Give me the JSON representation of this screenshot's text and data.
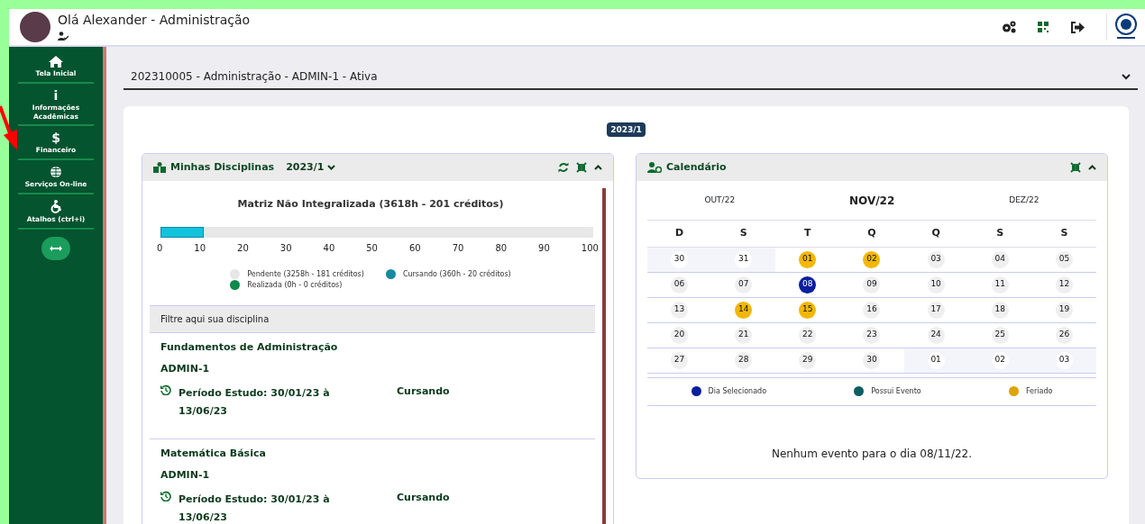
{
  "header": {
    "greeting": "Olá Alexander - Administração"
  },
  "sidebar": {
    "items": [
      {
        "label": "Tela Inicial",
        "kind": "home"
      },
      {
        "label": "Informações Acadêmicas",
        "kind": "glyph",
        "glyph": "i"
      },
      {
        "label": "Financeiro",
        "kind": "glyph",
        "glyph": "$"
      },
      {
        "label": "Serviços On-line",
        "kind": "globe"
      },
      {
        "label": "Atalhos (ctrl+i)",
        "kind": "access"
      }
    ]
  },
  "course_select": {
    "value": "202310005 - Administração - ADMIN-1 - Ativa"
  },
  "period_badge": "2023/1",
  "disciplinas": {
    "title": "Minhas Disciplinas",
    "period": "2023/1",
    "progress": {
      "title": "Matriz Não Integralizada (3618h - 201 créditos)",
      "level": 0.1,
      "ticks": [
        "0",
        "10",
        "20",
        "30",
        "40",
        "50",
        "60",
        "70",
        "80",
        "90",
        "100"
      ]
    },
    "legend": [
      {
        "label": "Pendente (3258h - 181 créditos)",
        "color": "#e6e6e6"
      },
      {
        "label": "Cursando (360h - 20 créditos)",
        "color": "#138a9e"
      },
      {
        "label": "Realizada (0h - 0 créditos)",
        "color": "#0b8a4a"
      }
    ],
    "filter": {
      "placeholder": "Filtre aqui sua disciplina"
    },
    "items": [
      {
        "name": "Fundamentos de Administração",
        "code": "ADMIN-1",
        "period": "Período Estudo: 30/01/23 à 13/06/23",
        "status": "Cursando"
      },
      {
        "name": "Matemática Básica",
        "code": "ADMIN-1",
        "period": "Período Estudo: 30/01/23 à 13/06/23",
        "status": "Cursando"
      }
    ]
  },
  "calendario": {
    "title": "Calendário",
    "prev": "OUT/22",
    "current": "NOV/22",
    "next": "DEZ/22",
    "weekdays": [
      "D",
      "S",
      "T",
      "Q",
      "Q",
      "S",
      "S"
    ],
    "weeks": [
      [
        {
          "day": "30",
          "kind": "other"
        },
        {
          "day": "31",
          "kind": "other"
        },
        {
          "day": "01",
          "kind": "holiday"
        },
        {
          "day": "02",
          "kind": "holiday"
        },
        {
          "day": "03",
          "kind": "normal"
        },
        {
          "day": "04",
          "kind": "normal"
        },
        {
          "day": "05",
          "kind": "normal"
        }
      ],
      [
        {
          "day": "06",
          "kind": "normal"
        },
        {
          "day": "07",
          "kind": "normal"
        },
        {
          "day": "08",
          "kind": "selected"
        },
        {
          "day": "09",
          "kind": "normal"
        },
        {
          "day": "10",
          "kind": "normal"
        },
        {
          "day": "11",
          "kind": "normal"
        },
        {
          "day": "12",
          "kind": "normal"
        }
      ],
      [
        {
          "day": "13",
          "kind": "normal"
        },
        {
          "day": "14",
          "kind": "holiday"
        },
        {
          "day": "15",
          "kind": "holiday"
        },
        {
          "day": "16",
          "kind": "normal"
        },
        {
          "day": "17",
          "kind": "normal"
        },
        {
          "day": "18",
          "kind": "normal"
        },
        {
          "day": "19",
          "kind": "normal"
        }
      ],
      [
        {
          "day": "20",
          "kind": "normal"
        },
        {
          "day": "21",
          "kind": "normal"
        },
        {
          "day": "22",
          "kind": "normal"
        },
        {
          "day": "23",
          "kind": "normal"
        },
        {
          "day": "24",
          "kind": "normal"
        },
        {
          "day": "25",
          "kind": "normal"
        },
        {
          "day": "26",
          "kind": "normal"
        }
      ],
      [
        {
          "day": "27",
          "kind": "normal"
        },
        {
          "day": "28",
          "kind": "normal"
        },
        {
          "day": "29",
          "kind": "normal"
        },
        {
          "day": "30",
          "kind": "normal"
        },
        {
          "day": "01",
          "kind": "other"
        },
        {
          "day": "02",
          "kind": "other"
        },
        {
          "day": "03",
          "kind": "other"
        }
      ]
    ],
    "legend": [
      {
        "label": "Dia Selecionado",
        "color": "#0a1f9e"
      },
      {
        "label": "Possui Evento",
        "color": "#0b5e63"
      },
      {
        "label": "Feriado",
        "color": "#e0a300"
      }
    ],
    "empty_message": "Nenhum evento para o dia 08/11/22."
  }
}
